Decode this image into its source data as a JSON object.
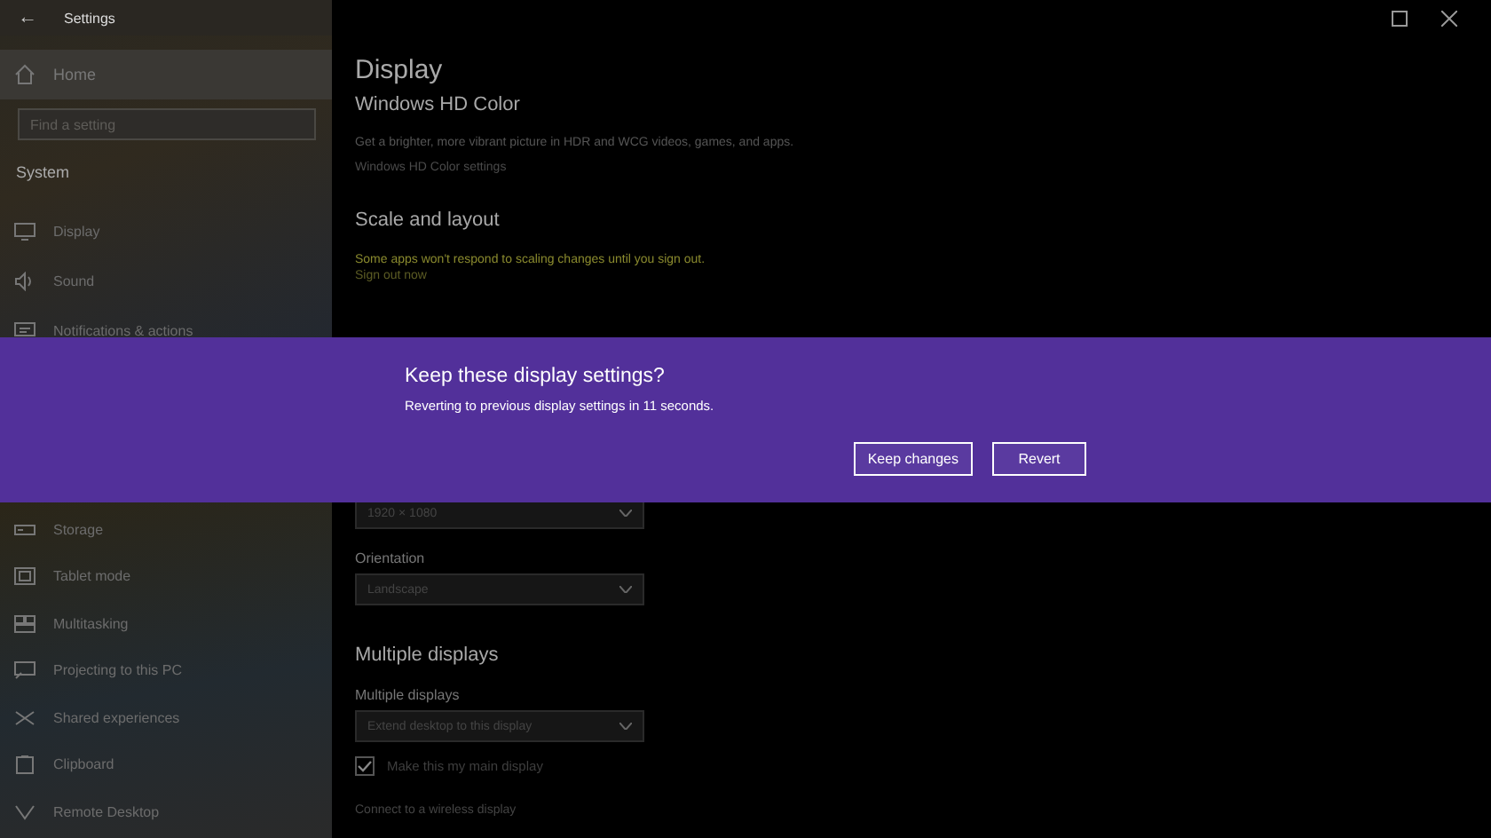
{
  "window": {
    "title": "Settings",
    "back": "←"
  },
  "sidebar": {
    "home": {
      "label": "Home",
      "selected": false
    },
    "search": {
      "placeholder": "Find a setting"
    },
    "section": "System",
    "items_top": [
      {
        "label": "Display",
        "selected": false
      },
      {
        "label": "Sound",
        "selected": false
      },
      {
        "label": "Notifications & actions",
        "selected": false
      }
    ],
    "items_bottom": [
      {
        "label": "Storage",
        "selected": false
      },
      {
        "label": "Tablet mode",
        "selected": false
      },
      {
        "label": "Multitasking",
        "selected": false
      },
      {
        "label": "Projecting to this PC",
        "selected": false
      },
      {
        "label": "Shared experiences",
        "selected": false
      },
      {
        "label": "Clipboard",
        "selected": false
      },
      {
        "label": "Remote Desktop",
        "selected": false
      }
    ]
  },
  "main": {
    "title": "Display",
    "hd_color": {
      "heading": "Windows HD Color",
      "description": "Get a brighter, more vibrant picture in HDR and WCG videos, games, and apps.",
      "link": "Windows HD Color settings"
    },
    "scale": {
      "heading": "Scale and layout",
      "warning": "Some apps won't respond to scaling changes until you sign out.",
      "link": "Sign out now"
    },
    "resolution": {
      "value": "1920 × 1080"
    },
    "orientation": {
      "label": "Orientation",
      "value": "Landscape"
    },
    "multiple": {
      "heading": "Multiple displays",
      "label": "Multiple displays",
      "value": "Extend desktop to this display",
      "checkbox": {
        "label": "Make this my main display",
        "checked": true
      },
      "link": "Connect to a wireless display"
    }
  },
  "dialog": {
    "title": "Keep these display settings?",
    "message": "Reverting to previous display settings in 11 seconds.",
    "buttons": [
      "Keep changes",
      "Revert"
    ]
  }
}
